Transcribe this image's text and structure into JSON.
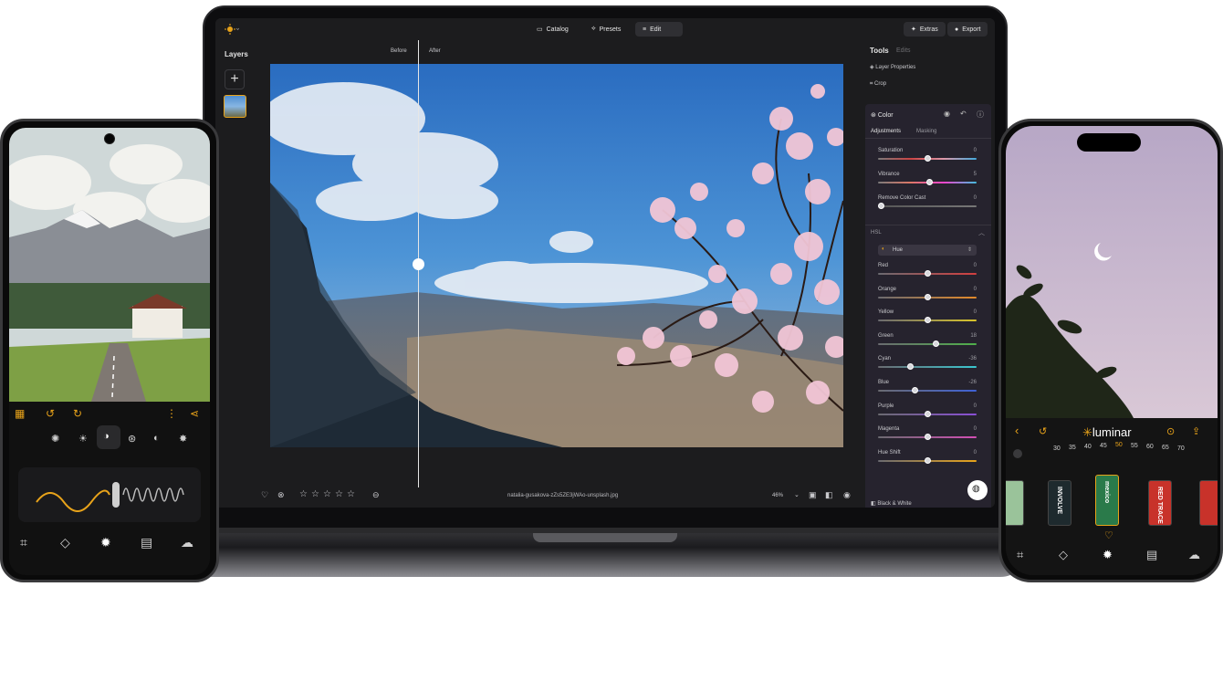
{
  "laptop": {
    "nav": {
      "catalog": "Catalog",
      "presets": "Presets",
      "edit": "Edit",
      "extras": "Extras",
      "export": "Export"
    },
    "layers": {
      "title": "Layers"
    },
    "compare": {
      "before": "Before",
      "after": "After"
    },
    "tools": {
      "title": "Tools",
      "edits": "Edits",
      "layer_properties": "Layer Properties",
      "crop": "Crop"
    },
    "color_panel": {
      "title": "Color",
      "tab_adjustments": "Adjustments",
      "tab_masking": "Masking",
      "sliders": [
        {
          "label": "Saturation",
          "value": "0",
          "level": 0.5
        },
        {
          "label": "Vibrance",
          "value": "5",
          "level": 0.52
        },
        {
          "label": "Remove Color Cast",
          "value": "0",
          "level": 0.0
        }
      ],
      "hsl_title": "HSL",
      "hsl_mode": "Hue",
      "hsl_sliders": [
        {
          "label": "Red",
          "value": "0",
          "level": 0.5
        },
        {
          "label": "Orange",
          "value": "0",
          "level": 0.5
        },
        {
          "label": "Yellow",
          "value": "0",
          "level": 0.5
        },
        {
          "label": "Green",
          "value": "18",
          "level": 0.59
        },
        {
          "label": "Cyan",
          "value": "-36",
          "level": 0.32
        },
        {
          "label": "Blue",
          "value": "-26",
          "level": 0.37
        },
        {
          "label": "Purple",
          "value": "0",
          "level": 0.5
        },
        {
          "label": "Magenta",
          "value": "0",
          "level": 0.5
        },
        {
          "label": "Hue Shift",
          "value": "0",
          "level": 0.5
        }
      ],
      "black_white": "Black & White"
    },
    "bottom": {
      "filename": "natalia-gusakova-zZs5ZE3jWAo-unsplash.jpg",
      "zoom": "46%"
    }
  },
  "iphone": {
    "brand": "luminar",
    "dial_numbers": [
      "30",
      "35",
      "40",
      "45",
      "50",
      "55",
      "60",
      "65",
      "70"
    ],
    "films": [
      "",
      "INVOLVE",
      "mexico",
      "RED TRACE",
      ""
    ]
  },
  "colors": {
    "accent": "#e8a31a",
    "panel": "#1c1c1e",
    "color_panel": "#26232e"
  }
}
